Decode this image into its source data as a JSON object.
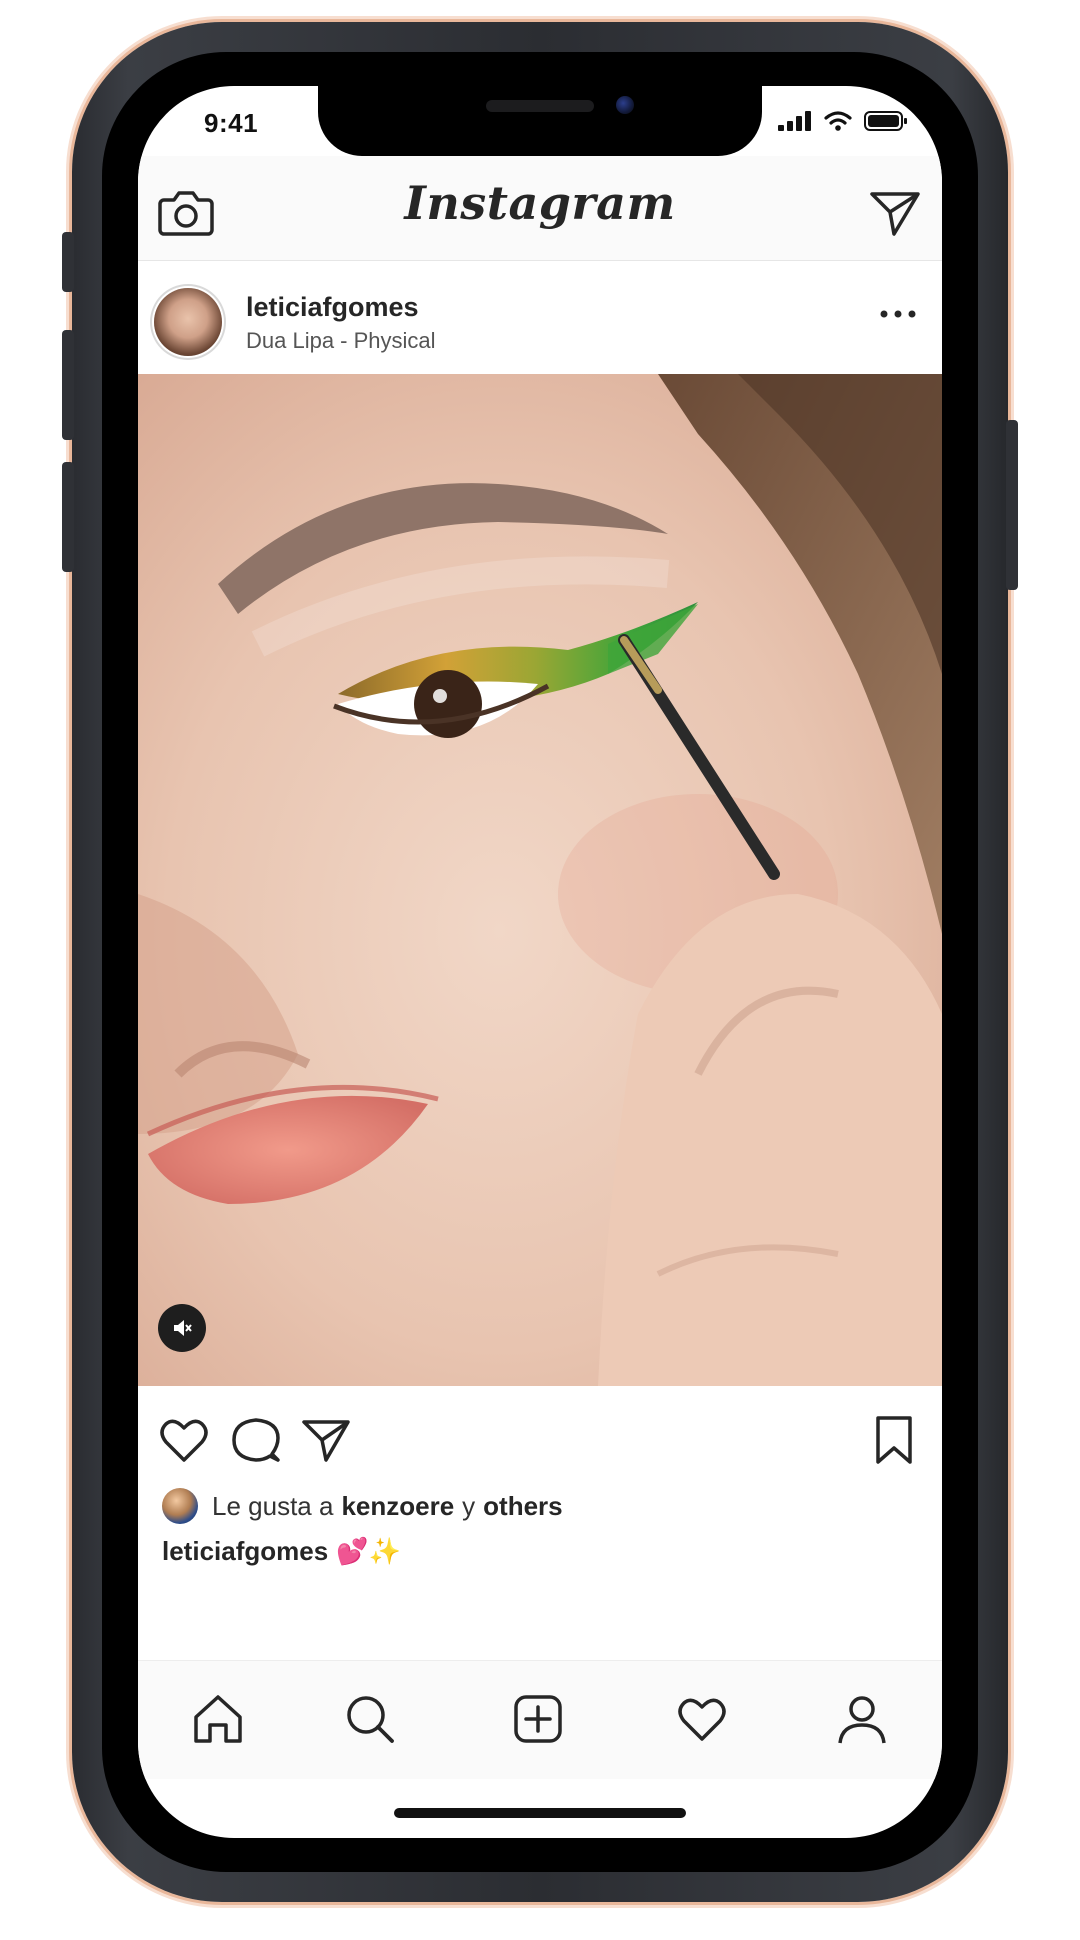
{
  "status_bar": {
    "time": "9:41",
    "icons": [
      "signal-icon",
      "wifi-icon",
      "battery-icon"
    ]
  },
  "top_nav": {
    "logo_text": "Instagram",
    "left_icon": "camera-icon",
    "right_icon": "direct-send-icon"
  },
  "post": {
    "username": "leticiafgomes",
    "audio": "Dua Lipa - Physical",
    "more_icon": "more-options-icon",
    "media_icon": "audio-muted-icon"
  },
  "actions": {
    "icons": [
      "heart-icon",
      "comment-icon",
      "share-icon",
      "bookmark-icon"
    ]
  },
  "likes": {
    "prefix": "Le gusta a",
    "user": "kenzoere",
    "joiner": "y",
    "others": "others"
  },
  "caption": {
    "username": "leticiafgomes",
    "emoji": "💕✨"
  },
  "tab_bar": {
    "icons": [
      "home-icon",
      "search-icon",
      "new-post-icon",
      "activity-heart-icon",
      "profile-icon"
    ]
  },
  "colors": {
    "text_primary": "#262626",
    "nav_background": "#fafafa",
    "phone_body": "#2b2d32",
    "phone_edge_accent": "#e9b79a"
  }
}
